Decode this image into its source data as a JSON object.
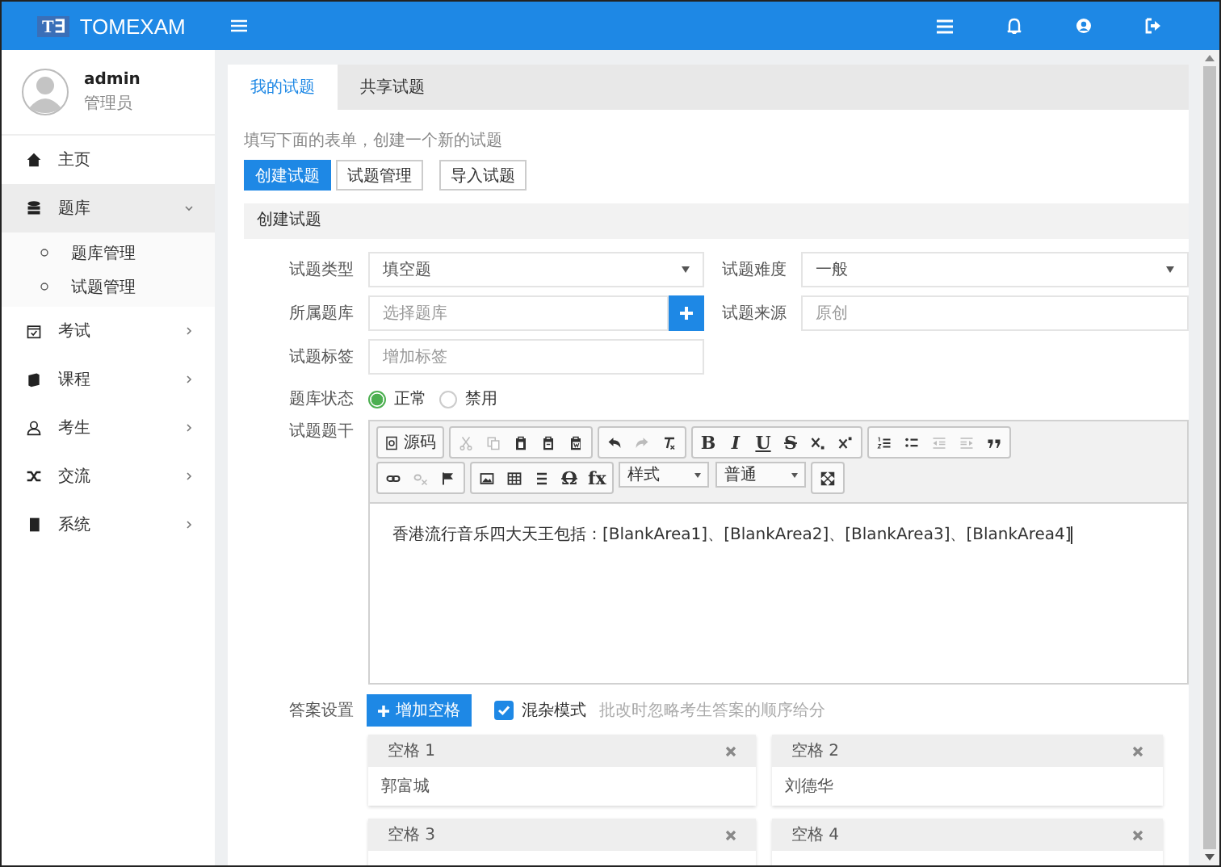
{
  "header": {
    "logo_mark": "T∃",
    "brand": "TOMEXAM"
  },
  "user": {
    "name": "admin",
    "role": "管理员"
  },
  "sidebar": {
    "items": [
      {
        "label": "主页",
        "selected": false
      },
      {
        "label": "题库",
        "selected": true,
        "expanded": true,
        "children": [
          {
            "label": "题库管理",
            "selected": false
          },
          {
            "label": "试题管理",
            "selected": false
          }
        ]
      },
      {
        "label": "考试",
        "selected": false,
        "expanded": false
      },
      {
        "label": "课程",
        "selected": false,
        "expanded": false
      },
      {
        "label": "考生",
        "selected": false,
        "expanded": false
      },
      {
        "label": "交流",
        "selected": false,
        "expanded": false
      },
      {
        "label": "系统",
        "selected": false,
        "expanded": false
      }
    ]
  },
  "tabs": [
    {
      "label": "我的试题",
      "selected": true
    },
    {
      "label": "共享试题",
      "selected": false
    }
  ],
  "intro": "填写下面的表单，创建一个新的试题",
  "actions": [
    {
      "label": "创建试题",
      "selected": true
    },
    {
      "label": "试题管理",
      "selected": false
    },
    {
      "label": "导入试题",
      "selected": false
    }
  ],
  "panel_title": "创建试题",
  "form": {
    "type": {
      "label": "试题类型",
      "value": "填空题"
    },
    "difficulty": {
      "label": "试题难度",
      "value": "一般"
    },
    "bank": {
      "label": "所属题库",
      "placeholder": "选择题库"
    },
    "source": {
      "label": "试题来源",
      "placeholder": "原创"
    },
    "tags": {
      "label": "试题标签",
      "placeholder": "增加标签"
    },
    "status": {
      "label": "题库状态",
      "options": [
        {
          "label": "正常",
          "selected": true
        },
        {
          "label": "禁用",
          "selected": false
        }
      ]
    },
    "stem_label": "试题题干",
    "answer_label": "答案设置"
  },
  "editor": {
    "toolbar": [
      [
        [
          {
            "kind": "textbutton",
            "label": "源码",
            "disabled": false
          }
        ],
        [
          {
            "kind": "icon",
            "disabled": true
          },
          {
            "kind": "icon",
            "disabled": true
          },
          {
            "kind": "icon",
            "disabled": false
          },
          {
            "kind": "icon",
            "disabled": false
          },
          {
            "kind": "icon",
            "disabled": false
          }
        ],
        [
          {
            "kind": "icon",
            "disabled": false
          },
          {
            "kind": "icon",
            "disabled": true
          },
          {
            "kind": "icon",
            "disabled": false
          }
        ],
        [
          {
            "kind": "text",
            "label": "B",
            "disabled": false
          },
          {
            "kind": "text",
            "label": "I",
            "disabled": false
          },
          {
            "kind": "text",
            "label": "U",
            "disabled": false
          },
          {
            "kind": "text",
            "label": "S",
            "disabled": false
          },
          {
            "kind": "icon",
            "disabled": false
          },
          {
            "kind": "icon",
            "disabled": false
          }
        ],
        [
          {
            "kind": "icon",
            "disabled": false
          },
          {
            "kind": "icon",
            "disabled": false
          },
          {
            "kind": "icon",
            "disabled": true
          },
          {
            "kind": "icon",
            "disabled": true
          },
          {
            "kind": "icon",
            "disabled": false
          }
        ]
      ],
      [
        [
          {
            "kind": "icon",
            "disabled": false
          },
          {
            "kind": "icon",
            "disabled": true
          },
          {
            "kind": "icon",
            "disabled": false
          }
        ],
        [
          {
            "kind": "icon",
            "disabled": false
          },
          {
            "kind": "icon",
            "disabled": false
          },
          {
            "kind": "icon",
            "disabled": false
          },
          {
            "kind": "text",
            "label": "Ω",
            "disabled": false
          },
          {
            "kind": "text",
            "label": "fx",
            "disabled": false
          }
        ],
        [
          {
            "kind": "select",
            "label": "样式",
            "disabled": false
          },
          {
            "kind": "select",
            "label": "普通",
            "disabled": false
          }
        ],
        [
          {
            "kind": "icon",
            "disabled": false
          }
        ]
      ]
    ],
    "content": "香港流行音乐四大天王包括：[BlankArea1]、[BlankArea2]、[BlankArea3]、[BlankArea4]"
  },
  "answers": {
    "add_button": "增加空格",
    "mixed": {
      "label": "混杂模式",
      "checked": true,
      "hint": "批改时忽略考生答案的顺序给分"
    },
    "blanks": [
      {
        "title": "空格 1",
        "value": "郭富城"
      },
      {
        "title": "空格 2",
        "value": "刘德华"
      },
      {
        "title": "空格 3"
      },
      {
        "title": "空格 4"
      }
    ]
  }
}
